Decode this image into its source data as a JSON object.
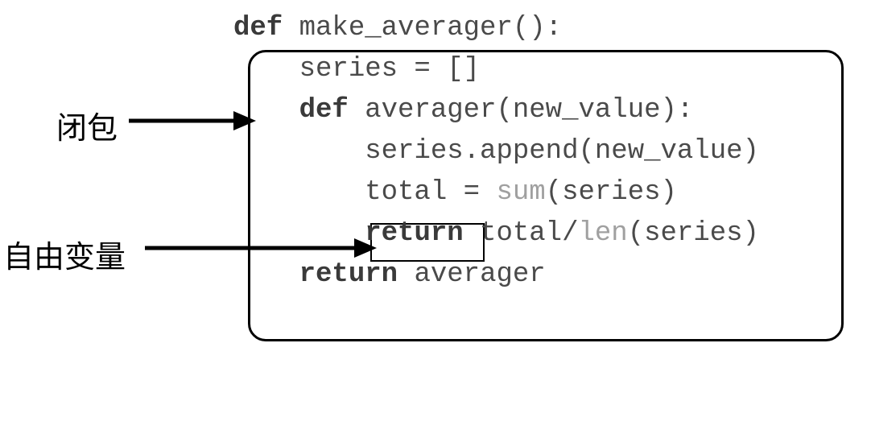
{
  "labels": {
    "closure": "闭包",
    "free_variable": "自由变量"
  },
  "code": {
    "line1_def": "def",
    "line1_rest": " make_averager():",
    "line2": "    series = []",
    "line3": "",
    "line4_def": "def",
    "line4_rest": " averager(new_value):",
    "line5_indent": "        ",
    "line5_series": "series",
    "line5_rest": ".append(new_value)",
    "line6_pre": "        total = ",
    "line6_sum": "sum",
    "line6_post": "(series)",
    "line7_indent": "        ",
    "line7_return": "return",
    "line7_mid": " total/",
    "line7_len": "len",
    "line7_post": "(series)",
    "line8": "",
    "line9_indent": "    ",
    "line9_return": "return",
    "line9_rest": " averager"
  }
}
